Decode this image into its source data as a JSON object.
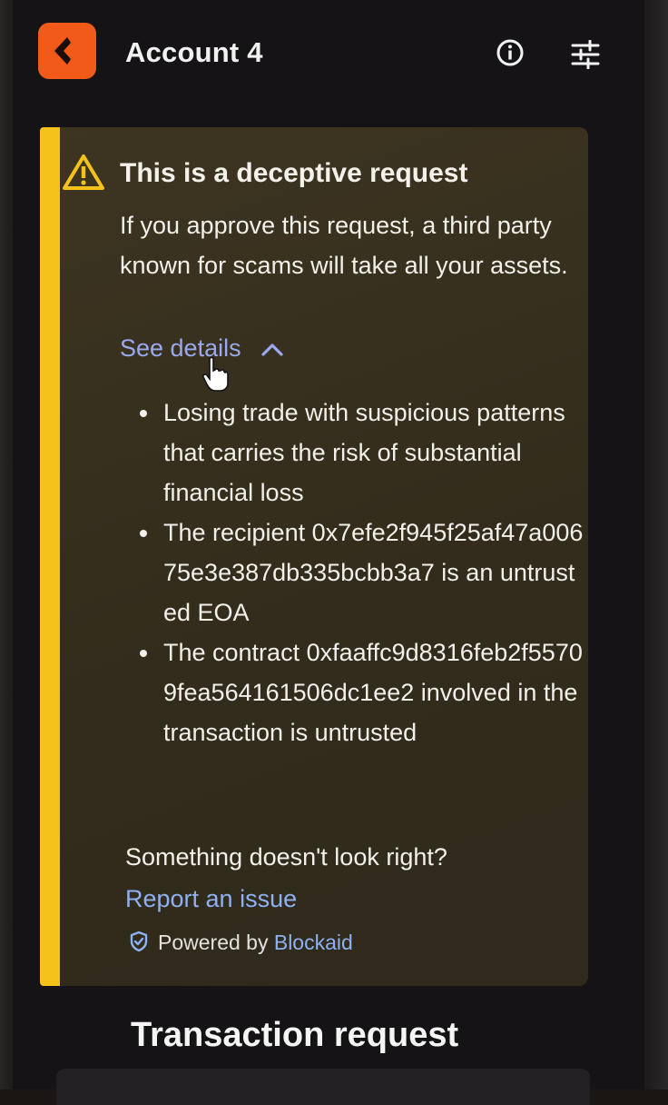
{
  "header": {
    "account_name": "Account 4",
    "logo_icon": "metamask-style-logo-icon",
    "info_icon": "info-circle-icon",
    "settings_icon": "sliders-icon"
  },
  "alert": {
    "title": "This is a deceptive request",
    "description": "If you approve this request, a third party known for scams will take all your assets.",
    "see_details_label": "See details",
    "details": [
      "Losing trade with suspicious patterns that carries the risk of substantial financial loss",
      "The recipient 0x7efe2f945f25af47a00675e3e387db335bcbb3a7 is an untrusted EOA",
      "The contract 0xfaaffc9d8316feb2f55709fea564161506dc1ee2 involved in the transaction is untrusted"
    ],
    "question": "Something doesn't look right?",
    "report_link": "Report an issue",
    "powered_prefix": "Powered by",
    "powered_brand": "Blockaid",
    "colors": {
      "accent_bar": "#f4c21a",
      "link": "#8fb0f2",
      "background": "#3a3220"
    }
  },
  "transaction": {
    "title": "Transaction request"
  }
}
